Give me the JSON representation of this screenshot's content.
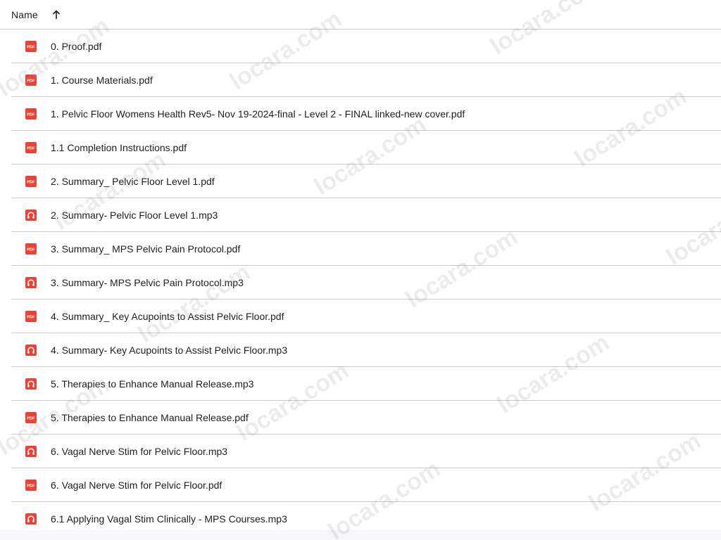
{
  "header": {
    "name_label": "Name",
    "sort_icon": "arrow-up-icon"
  },
  "files": [
    {
      "name": "0. Proof.pdf",
      "type": "pdf"
    },
    {
      "name": "1. Course Materials.pdf",
      "type": "pdf"
    },
    {
      "name": "1. Pelvic Floor Womens Health Rev5- Nov 19-2024-final - Level 2 - FINAL linked-new cover.pdf",
      "type": "pdf"
    },
    {
      "name": "1.1 Completion Instructions.pdf",
      "type": "pdf"
    },
    {
      "name": "2. Summary_ Pelvic Floor Level 1.pdf",
      "type": "pdf"
    },
    {
      "name": "2. Summary- Pelvic Floor Level 1.mp3",
      "type": "audio"
    },
    {
      "name": "3. Summary_ MPS Pelvic Pain Protocol.pdf",
      "type": "pdf"
    },
    {
      "name": "3. Summary- MPS Pelvic Pain Protocol.mp3",
      "type": "audio"
    },
    {
      "name": "4. Summary_ Key Acupoints to Assist Pelvic Floor.pdf",
      "type": "pdf"
    },
    {
      "name": "4. Summary- Key Acupoints to Assist Pelvic Floor.mp3",
      "type": "audio"
    },
    {
      "name": "5. Therapies to Enhance Manual Release.mp3",
      "type": "audio"
    },
    {
      "name": "5. Therapies to Enhance Manual Release.pdf",
      "type": "pdf"
    },
    {
      "name": "6. Vagal Nerve Stim for Pelvic Floor.mp3",
      "type": "audio"
    },
    {
      "name": "6. Vagal Nerve Stim for Pelvic Floor.pdf",
      "type": "pdf"
    },
    {
      "name": "6.1 Applying Vagal Stim Clinically - MPS Courses.mp3",
      "type": "audio"
    }
  ],
  "watermark": {
    "text": "locara.com"
  },
  "colors": {
    "file_icon_red": "#ea4335",
    "divider": "#c7c7c7",
    "text": "#1f1f1f"
  }
}
